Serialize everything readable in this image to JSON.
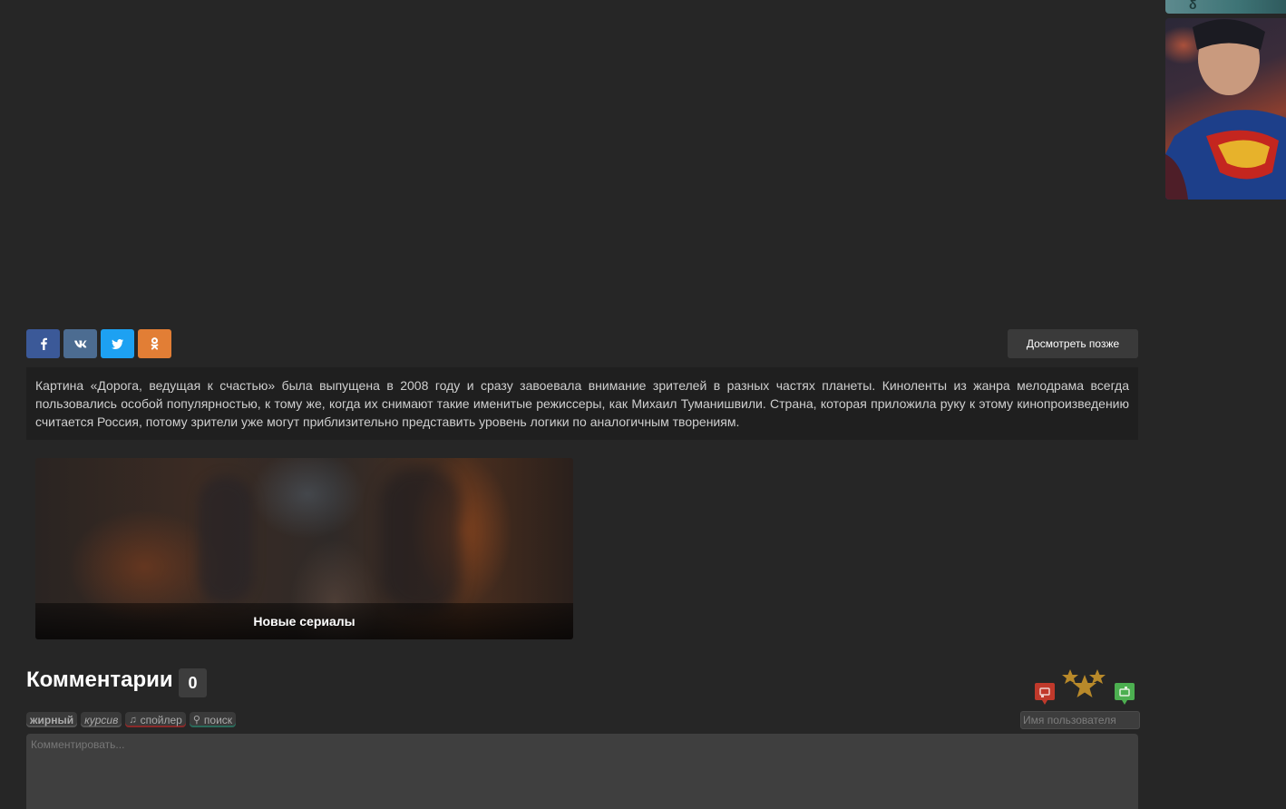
{
  "share": {
    "buttons": [
      {
        "name": "facebook",
        "glyph": "f",
        "color": "#3b5998"
      },
      {
        "name": "vk",
        "glyph": "vk",
        "color": "#4c6c91"
      },
      {
        "name": "twitter",
        "glyph": "t",
        "color": "#1da1f2"
      },
      {
        "name": "odnoklassniki",
        "glyph": "ok",
        "color": "#e27e35"
      }
    ]
  },
  "watch_later": {
    "label": "Досмотреть позже"
  },
  "description": {
    "text": "Картина «Дорога, ведущая к счастью» была выпущена в 2008 году и сразу завоевала внимание зрителей в разных частях планеты. Киноленты из жанра мелодрама всегда пользовались особой популярностью, к тому же, когда их снимают такие именитые режиссеры, как Михаил Туманишвили. Страна, которая приложила руку к этому кинопроизведению считается Россия, потому зрители уже могут приблизительно представить уровень логики по аналогичным творениям."
  },
  "related": {
    "caption": "Новые сериалы"
  },
  "comments": {
    "title": "Комментарии",
    "count": "0",
    "format_buttons": {
      "bold": "жирный",
      "italic": "курсив",
      "spoiler": "спойлер",
      "search": "поиск"
    },
    "username_placeholder": "Имя пользователя",
    "comment_placeholder": "Комментировать..."
  },
  "rating": {
    "down_color": "#c0392b",
    "up_color": "#4caf50",
    "star_color": "#b8892a"
  }
}
